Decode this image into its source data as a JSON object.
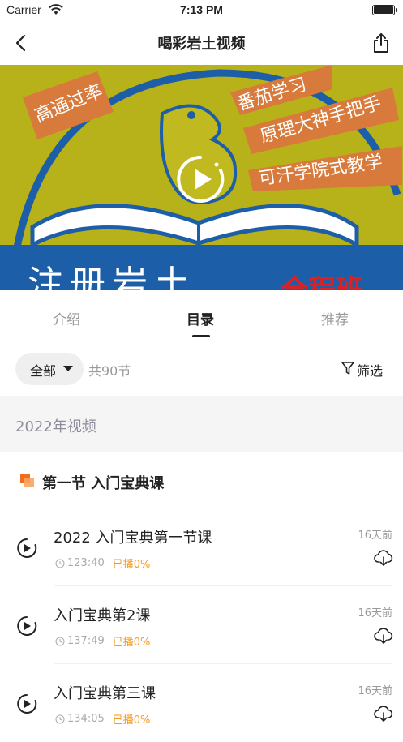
{
  "status": {
    "carrier": "Carrier",
    "time": "7:13 PM"
  },
  "nav": {
    "title": "喝彩岩土视频"
  },
  "video": {
    "banners": [
      "高通过率",
      "番茄学习",
      "原理大神手把手",
      "可汗学院式教学"
    ],
    "bottom_text": "注册岩土",
    "bottom_red": "全程班"
  },
  "tabs": [
    {
      "label": "介绍"
    },
    {
      "label": "目录"
    },
    {
      "label": "推荐"
    }
  ],
  "filter": {
    "all_label": "全部",
    "count": "共90节",
    "screen_label": "筛选"
  },
  "year_label": "2022年视频",
  "section_title": "第一节 入门宝典课",
  "items": [
    {
      "name": "2022 入门宝典第一节课",
      "duration": "123:40",
      "played": "已播0%",
      "ago": "16天前"
    },
    {
      "name": "入门宝典第2课",
      "duration": "137:49",
      "played": "已播0%",
      "ago": "16天前"
    },
    {
      "name": "入门宝典第三课",
      "duration": "134:05",
      "played": "已播0%",
      "ago": "16天前"
    }
  ],
  "colors": {
    "accent": "#f59a23",
    "banner_yellow": "#b8b21a",
    "banner_blue": "#1d5ea8",
    "banner_orange": "#d87a3b"
  }
}
